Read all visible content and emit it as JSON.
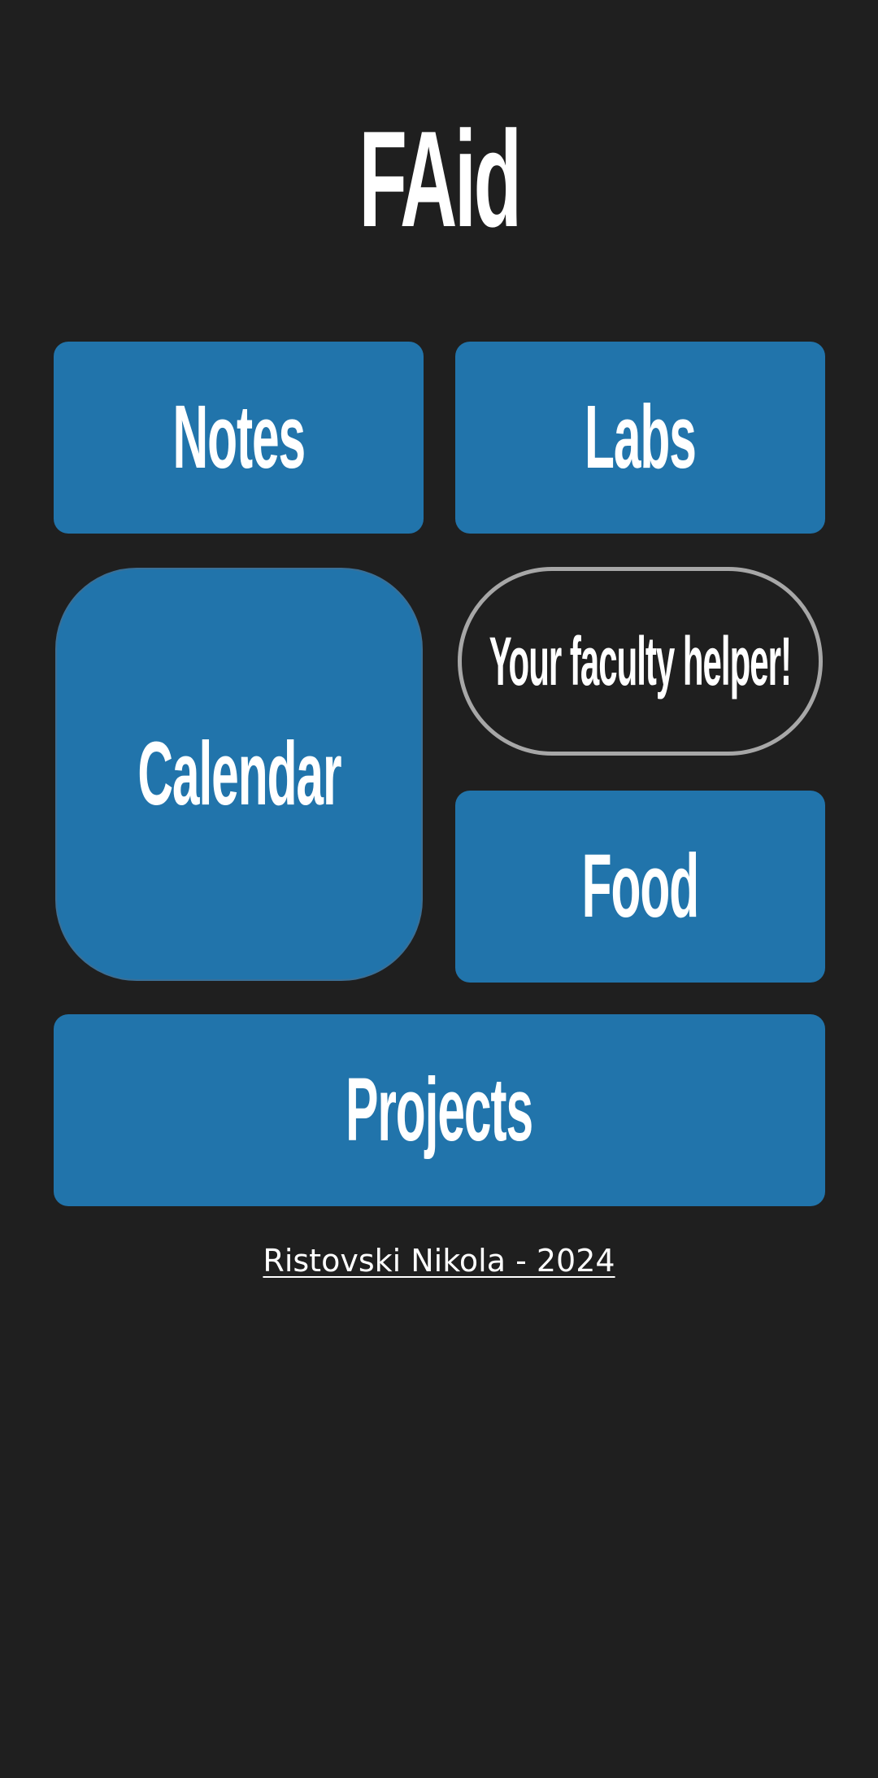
{
  "app": {
    "title": "FAid"
  },
  "tiles": {
    "notes": "Notes",
    "labs": "Labs",
    "calendar": "Calendar",
    "food": "Food",
    "projects": "Projects"
  },
  "tagline": "Your faculty helper!",
  "footer": {
    "credit": "Ristovski Nikola - 2024"
  },
  "colors": {
    "background": "#1f1f1f",
    "tile": "#2174ab",
    "tagline_border": "#a7a7a7",
    "text": "#ffffff"
  }
}
